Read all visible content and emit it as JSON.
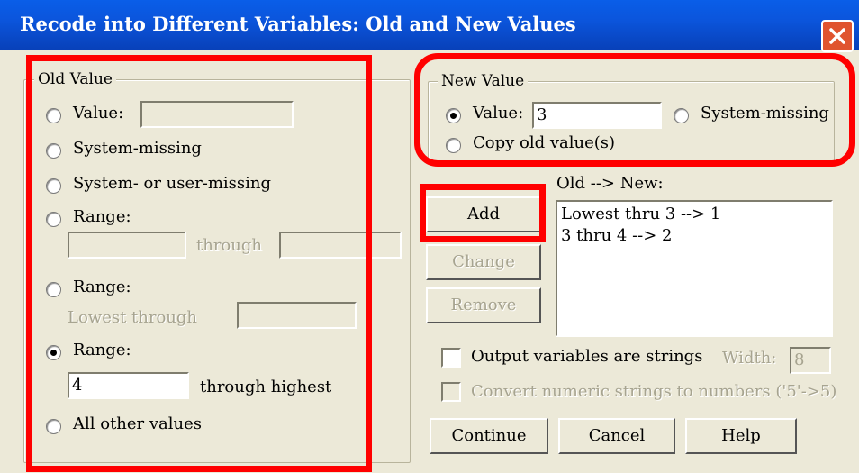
{
  "window": {
    "title": "Recode into Different Variables: Old and New Values"
  },
  "old_value": {
    "legend": "Old Value",
    "value_label": "Value:",
    "value_input": "",
    "system_missing_label": "System-missing",
    "system_or_user_missing_label": "System- or user-missing",
    "range1_label": "Range:",
    "range1_through": "through",
    "range2_label": "Range:",
    "range2_lowest_through": "Lowest through",
    "range3_label": "Range:",
    "range3_value": "4",
    "range3_through_highest": "through highest",
    "all_other_label": "All other values",
    "selected": "range3"
  },
  "new_value": {
    "legend": "New Value",
    "value_label": "Value:",
    "value_input": "3",
    "system_missing_label": "System-missing",
    "copy_old_label": "Copy old value(s)",
    "selected": "value"
  },
  "mapping": {
    "label": "Old --> New:",
    "items": [
      "Lowest thru 3 --> 1",
      "3 thru 4 --> 2"
    ]
  },
  "buttons": {
    "add": "Add",
    "change": "Change",
    "remove": "Remove",
    "continue": "Continue",
    "cancel": "Cancel",
    "help": "Help"
  },
  "options": {
    "output_strings_label": "Output variables are strings",
    "width_label": "Width:",
    "width_value": "8",
    "convert_label": "Convert numeric strings to numbers ('5'->5)"
  },
  "colors": {
    "highlight": "#ff0000",
    "titlebar": "#0a5ee8",
    "dialog_bg": "#ece9d8"
  }
}
